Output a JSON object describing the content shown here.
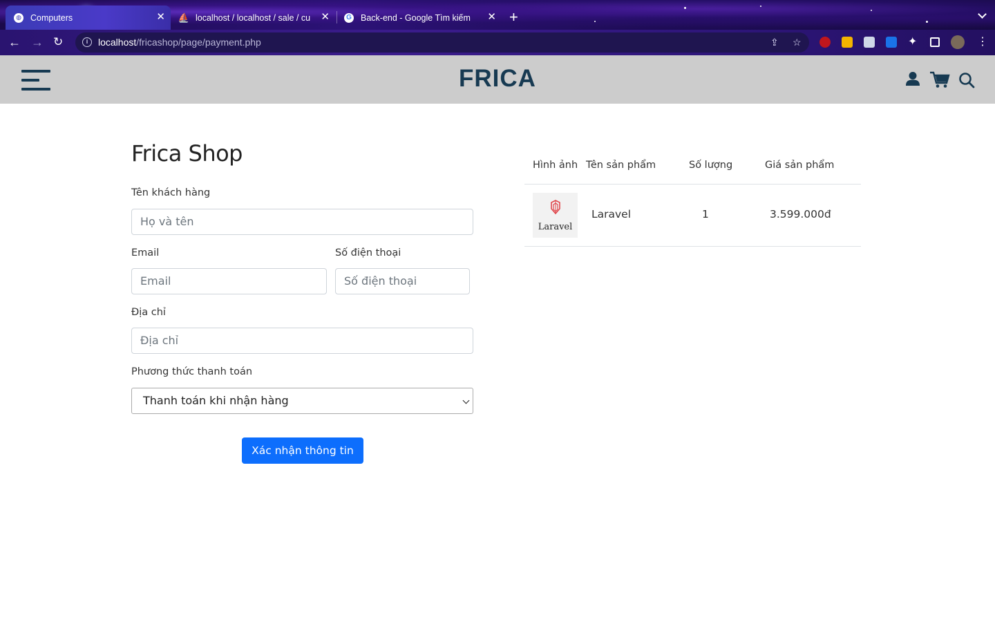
{
  "browser": {
    "tabs": [
      {
        "label": "Computers",
        "active": true
      },
      {
        "label": "localhost / localhost / sale / cu",
        "active": false
      },
      {
        "label": "Back-end - Google Tìm kiếm",
        "active": false
      }
    ],
    "url_host": "localhost",
    "url_path": "/fricashop/page/payment.php"
  },
  "header": {
    "brand": "FRICA",
    "brand_color": "#173a52",
    "background": "#cccccc"
  },
  "form": {
    "title": "Frica Shop",
    "name_label": "Tên khách hàng",
    "name_placeholder": "Họ và tên",
    "email_label": "Email",
    "email_placeholder": "Email",
    "phone_label": "Số điện thoại",
    "phone_placeholder": "Số điện thoại",
    "address_label": "Địa chỉ",
    "address_placeholder": "Địa chỉ",
    "payment_label": "Phương thức thanh toán",
    "payment_selected": "Thanh toán khi nhận hàng",
    "submit_label": "Xác nhận thông tin",
    "submit_color": "#0d6efd"
  },
  "cart": {
    "columns": [
      "Hình ảnh",
      "Tên sản phẩm",
      "Số lượng",
      "Giá sản phẩm"
    ],
    "rows": [
      {
        "image_text": "Laravel",
        "name": "Laravel",
        "quantity": "1",
        "price": "3.599.000đ"
      }
    ]
  }
}
